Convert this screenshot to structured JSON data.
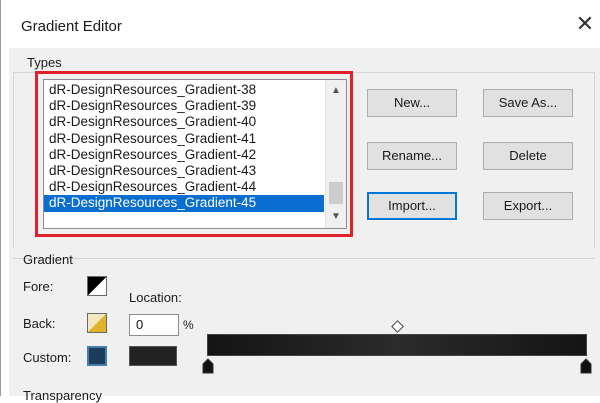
{
  "window": {
    "title": "Gradient Editor",
    "close_glyph": "✕"
  },
  "types": {
    "label": "Types",
    "items": [
      "dR-DesignResources_Gradient-38",
      "dR-DesignResources_Gradient-39",
      "dR-DesignResources_Gradient-40",
      "dR-DesignResources_Gradient-41",
      "dR-DesignResources_Gradient-42",
      "dR-DesignResources_Gradient-43",
      "dR-DesignResources_Gradient-44",
      "dR-DesignResources_Gradient-45"
    ],
    "selected_item": "dR-DesignResources_Gradient-45",
    "buttons": {
      "new": "New...",
      "save_as": "Save As...",
      "rename": "Rename...",
      "delete": "Delete",
      "import": "Import...",
      "export": "Export..."
    }
  },
  "gradient": {
    "label": "Gradient",
    "fore_label": "Fore:",
    "back_label": "Back:",
    "custom_label": "Custom:",
    "location_label": "Location:",
    "location_value": "0",
    "percent_sign": "%",
    "custom_color": "#222222"
  },
  "transparency": {
    "label": "Transparency"
  },
  "colors": {
    "selection": "#0a6ed1",
    "highlight_box": "#e0202a",
    "default_button_border": "#0078d7"
  },
  "icons": {
    "close": "close-icon",
    "scroll_up": "scroll-up-arrow-icon",
    "scroll_down": "scroll-down-arrow-icon",
    "fore_swatch": "fore-color-swatch-icon",
    "back_swatch": "back-color-swatch-icon",
    "custom_swatch": "custom-color-swatch-icon",
    "color_stop": "color-stop-icon",
    "midpoint": "midpoint-diamond-icon"
  }
}
